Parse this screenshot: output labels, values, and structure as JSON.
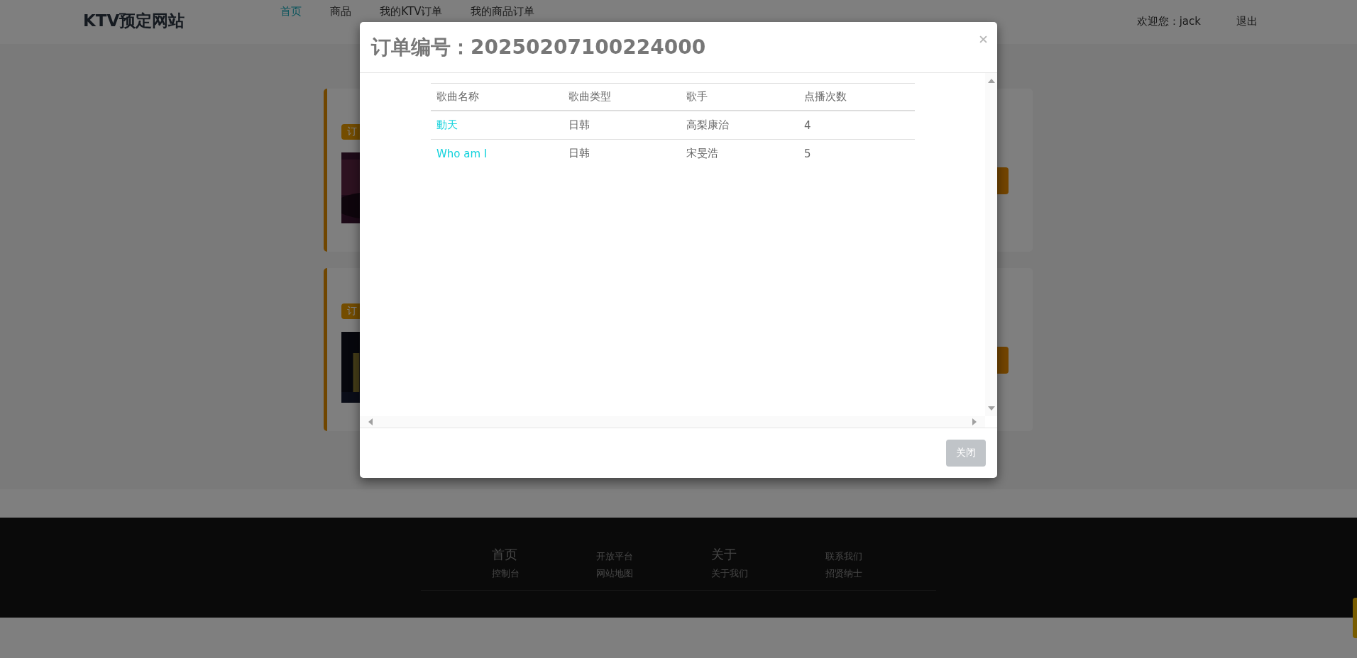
{
  "header": {
    "brand": "KTV预定网站",
    "nav": [
      {
        "label": "首页",
        "selected": true
      },
      {
        "label": "商品",
        "selected": false
      },
      {
        "label": "我的KTV订单",
        "selected": false
      },
      {
        "label": "我的商品订单",
        "selected": false
      }
    ],
    "welcome": "欢迎您：jack",
    "logout": "退出"
  },
  "orders": [
    {
      "tag": "订",
      "kind": "picture"
    },
    {
      "tag": "订",
      "kind": "picture"
    }
  ],
  "modal": {
    "title": "订单编号：20250207100224000",
    "columns": [
      "歌曲名称",
      "歌曲类型",
      "歌手",
      "点播次数"
    ],
    "rows": [
      {
        "cells": [
          "動天",
          "日韩",
          "高梨康治",
          "4"
        ]
      },
      {
        "cells": [
          "Who am I",
          "日韩",
          "宋旻浩",
          "5"
        ]
      }
    ],
    "close_button": "关闭"
  },
  "footer": {
    "links": [
      {
        "label": "首页",
        "kind": "heading"
      },
      {
        "label": "开放平台",
        "kind": "link"
      },
      {
        "label": "关于",
        "kind": "heading"
      },
      {
        "label": "联系我们",
        "kind": "link"
      },
      {
        "label": "控制台",
        "kind": "link"
      },
      {
        "label": "网站地图",
        "kind": "link"
      },
      {
        "label": "关于我们",
        "kind": "link"
      },
      {
        "label": "招贤纳士",
        "kind": "link"
      }
    ]
  }
}
